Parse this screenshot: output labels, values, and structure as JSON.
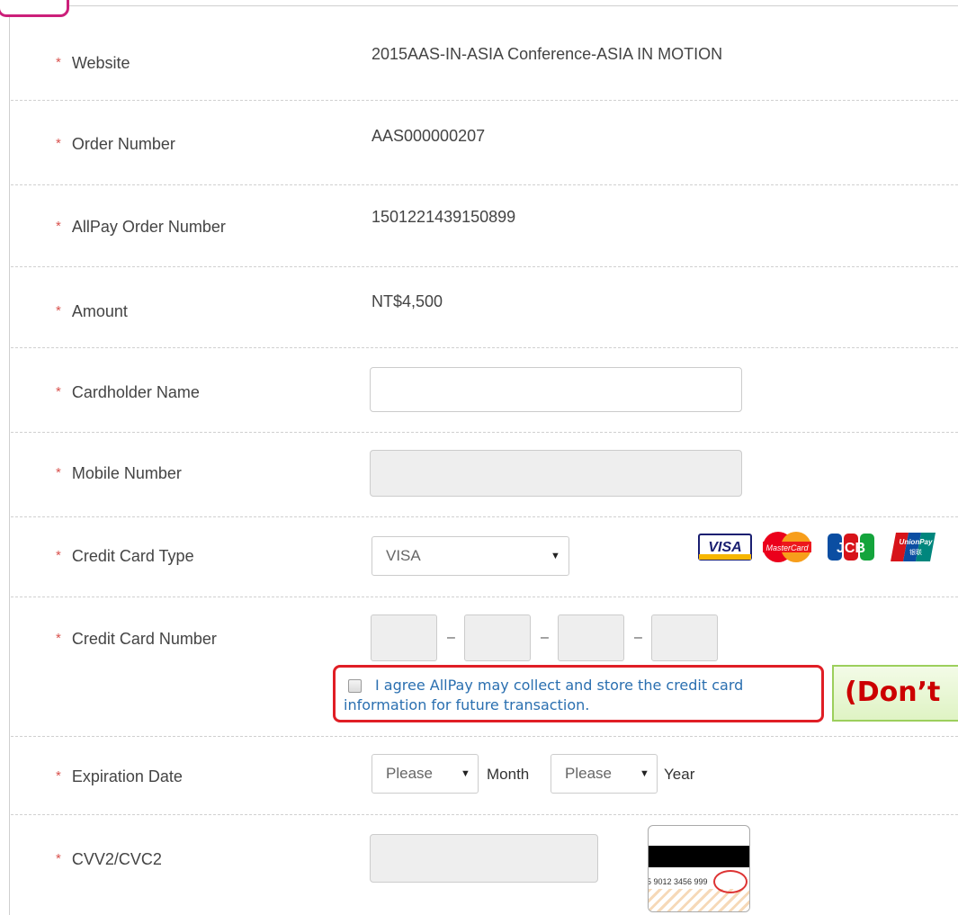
{
  "fields": {
    "website": {
      "label": "Website",
      "value": "2015AAS-IN-ASIA Conference-ASIA IN MOTION"
    },
    "order_number": {
      "label": "Order Number",
      "value": "AAS000000207"
    },
    "allpay_order_number": {
      "label": "AllPay Order Number",
      "value": "1501221439150899"
    },
    "amount": {
      "label": "Amount",
      "value": "NT$4,500"
    },
    "cardholder_name": {
      "label": "Cardholder Name",
      "value": ""
    },
    "mobile_number": {
      "label": "Mobile Number",
      "value": ""
    },
    "credit_card_type": {
      "label": "Credit Card Type",
      "selected": "VISA"
    },
    "credit_card_number": {
      "label": "Credit Card Number",
      "separator": "–"
    },
    "expiration_date": {
      "label": "Expiration Date",
      "month_selected": "Please",
      "month_label": "Month",
      "year_selected": "Please",
      "year_label": "Year"
    },
    "cvv": {
      "label": "CVV2/CVC2",
      "sample_digits": "5 9012 3456 999"
    }
  },
  "required_mark": "*",
  "agree": {
    "text": "I agree AllPay may collect and store the credit card information for future transaction.",
    "checked": false
  },
  "callout": {
    "text": "(Don’t"
  },
  "card_logos": [
    {
      "name": "VISA",
      "icon": "visa-logo",
      "color": "#1a1f71"
    },
    {
      "name": "MasterCard",
      "icon": "mastercard-logo",
      "color": "#eb001b"
    },
    {
      "name": "JCB",
      "icon": "jcb-logo",
      "color": "#0b4ea2"
    },
    {
      "name": "UnionPay 银联",
      "icon": "unionpay-logo",
      "color": "#d7141a"
    }
  ],
  "colors": {
    "required": "#d9534f",
    "highlight_border": "#e01e25",
    "callout_text": "#cc0000",
    "link_text": "#2a6fb0"
  }
}
